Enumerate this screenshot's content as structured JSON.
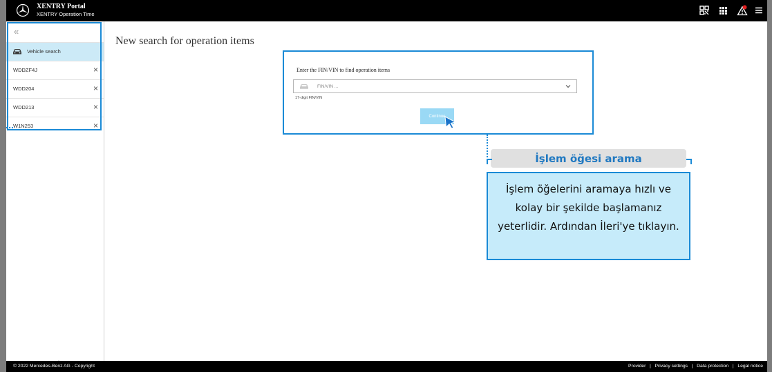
{
  "header": {
    "title": "XENTRY Portal",
    "subtitle": "XENTRY Operation Time"
  },
  "header_icons": [
    "qr-scan-icon",
    "apps-grid-icon",
    "alert-notification-icon",
    "menu-icon"
  ],
  "sidebar": {
    "collapse_label": "«",
    "items": [
      {
        "label": "Vehicle search",
        "icon": "car-icon",
        "active": true
      },
      {
        "label": "WDDZF4J",
        "closable": true
      },
      {
        "label": "WDD204",
        "closable": true
      },
      {
        "label": "WDD213",
        "closable": true
      },
      {
        "label": "W1N253",
        "closable": true
      }
    ],
    "close_glyph": "×"
  },
  "main": {
    "page_title": "New search for operation items",
    "search": {
      "label": "Enter the FIN/VIN to find operation items",
      "placeholder": "FIN/VIN ...",
      "hint": "17-digit FIN/VIN",
      "continue_label": "Continue"
    }
  },
  "tooltip": {
    "title": "İşlem öğesi arama",
    "body": "İşlem öğelerini aramaya hızlı ve kolay bir şekilde başlamanız yeterlidir. Ardından İleri'ye tıklayın."
  },
  "footer": {
    "copyright": "© 2022 Mercedes-Benz AG - Copyright",
    "links": "Provider   |   Privacy settings   |   Data protection   |   Legal notice"
  },
  "colors": {
    "accent": "#1a8ad6",
    "active_item": "#cceaf7",
    "continue_button": "#9ad9f5",
    "tooltip_bg": "#c6ebfa",
    "tooltip_title": "#1f78c1"
  }
}
